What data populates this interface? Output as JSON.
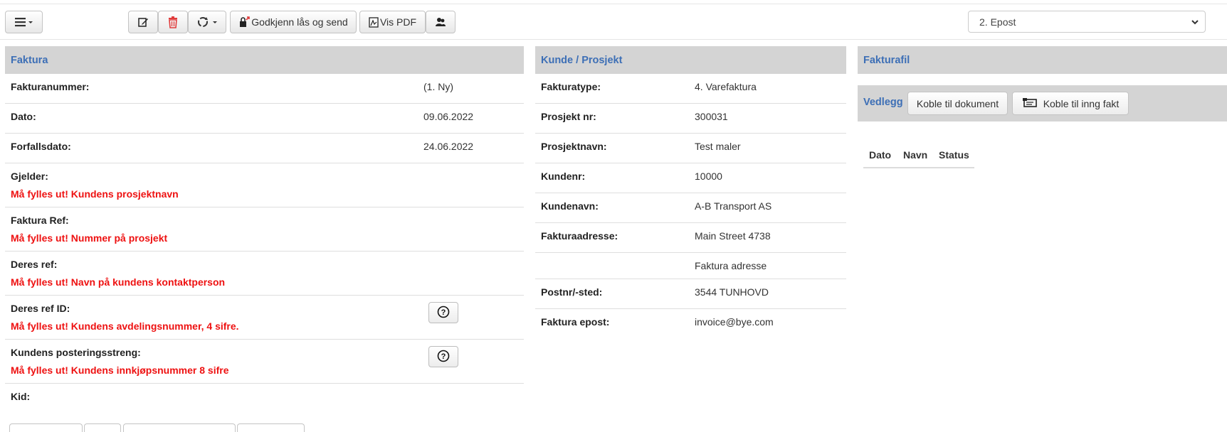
{
  "toolbar": {
    "approve_label": "Godkjenn lås og send",
    "pdf_label": "Vis PDF",
    "send_method": "2. Epost"
  },
  "faktura": {
    "header": "Faktura",
    "rows": [
      {
        "label": "Fakturanummer:",
        "value": "(1. Ny)"
      },
      {
        "label": "Dato:",
        "value": "09.06.2022"
      },
      {
        "label": "Forfallsdato:",
        "value": "24.06.2022"
      },
      {
        "label": "Gjelder:",
        "error": "Må fylles ut! Kundens prosjektnavn"
      },
      {
        "label": "Faktura Ref:",
        "error": "Må fylles ut! Nummer på prosjekt"
      },
      {
        "label": "Deres ref:",
        "error": "Må fylles ut! Navn på kundens kontaktperson"
      },
      {
        "label": "Deres ref ID:",
        "error": "Må fylles ut! Kundens avdelingsnummer, 4 sifre."
      },
      {
        "label": "Kundens posteringsstreng:",
        "error": "Må fylles ut! Kundens innkjøpsnummer 8 sifre"
      },
      {
        "label": "Kid:"
      }
    ]
  },
  "kunde": {
    "header": "Kunde / Prosjekt",
    "rows": [
      {
        "label": "Fakturatype:",
        "value": "4. Varefaktura"
      },
      {
        "label": "Prosjekt nr:",
        "value": "300031"
      },
      {
        "label": "Prosjektnavn:",
        "value": "Test maler"
      },
      {
        "label": "Kundenr:",
        "value": "10000"
      },
      {
        "label": "Kundenavn:",
        "value": "A-B Transport AS"
      },
      {
        "label": "Fakturaadresse:",
        "value": "Main Street 4738"
      },
      {
        "label": "",
        "value": "Faktura adresse"
      },
      {
        "label": "Postnr/-sted:",
        "value": "3544 TUNHOVD"
      },
      {
        "label": "Faktura epost:",
        "value": "invoice@bye.com"
      }
    ]
  },
  "fakturafil": {
    "header": "Fakturafil",
    "vedlegg_label": "Vedlegg",
    "link_document_label": "Koble til dokument",
    "link_invoice_label": "Koble til inng fakt",
    "columns": [
      "Dato",
      "Navn",
      "Status"
    ]
  },
  "colors": {
    "header_blue": "#3d6fb6",
    "error_red": "#ee1111",
    "header_gray": "#d4d4d4",
    "delete_red": "#e03b3b"
  },
  "icons": [
    "menu-icon",
    "edit-icon",
    "trash-icon",
    "refresh-icon",
    "lock-send-icon",
    "pdf-icon",
    "users-icon",
    "help-icon",
    "invoice-link-icon"
  ]
}
